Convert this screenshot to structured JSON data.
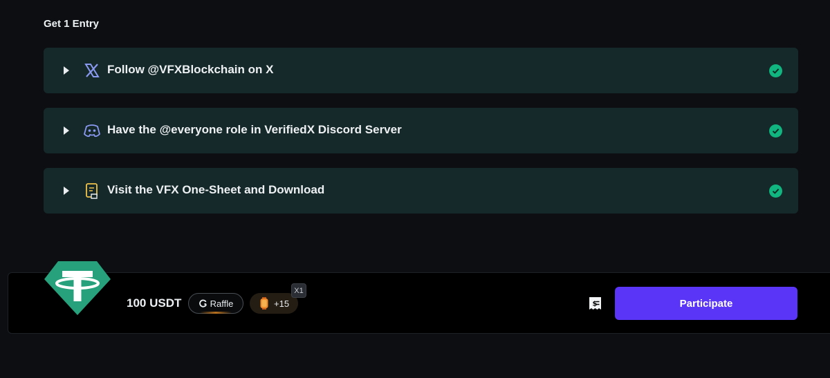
{
  "section": {
    "title": "Get 1 Entry"
  },
  "tasks": [
    {
      "label": "Follow @VFXBlockchain on X",
      "icon": "x-logo-icon",
      "status": "completed"
    },
    {
      "label": "Have the @everyone role in VerifiedX Discord Server",
      "icon": "discord-icon",
      "status": "completed"
    },
    {
      "label": "Visit the VFX One-Sheet and Download",
      "icon": "document-icon",
      "status": "completed"
    }
  ],
  "prize": {
    "amount": "100 USDT",
    "type_label": "Raffle",
    "points": "+15",
    "multiplier": "X1",
    "cta_label": "Participate"
  },
  "colors": {
    "background": "#0c0e11",
    "task_card": "#16292a",
    "check_green": "#10b57f",
    "tether_teal": "#26a17b",
    "cta": "#5a35f7"
  }
}
